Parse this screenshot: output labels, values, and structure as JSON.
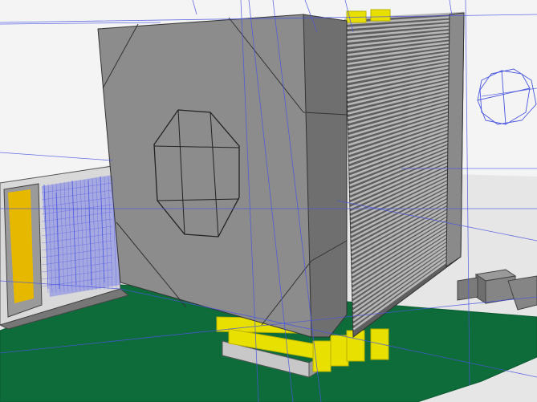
{
  "viewport": {
    "kind": "3d-cad-viewport",
    "render_mode": "shaded-with-wireframe-overlay"
  },
  "colors": {
    "background_top": "#f4f4f4",
    "background_floor": "#e6e6e6",
    "pcb": "#0e6b3a",
    "pcb_edge": "#0a5a30",
    "fan_face": "#8c8c8c",
    "fan_side": "#6f6f6f",
    "fin": "#b7b7b7",
    "fin_gap": "#5f5f5f",
    "heatpipe": "#e8e000",
    "heatpipe_dark": "#b9b200",
    "slot_yellow": "#e6b800",
    "wire_blue": "#4a55e0",
    "component_grey": "#7d7d7d",
    "socket_lever": "#c8c8c8"
  },
  "scene": {
    "objects": [
      "fan-shroud",
      "heatsink-fin-stack",
      "heatpipes",
      "motherboard-pcb",
      "ram-slots",
      "expansion-card",
      "vrm-chokes",
      "wireframe-guides"
    ]
  }
}
